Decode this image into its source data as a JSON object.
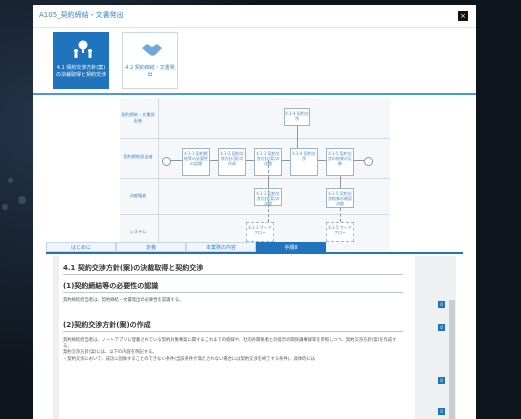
{
  "modal": {
    "title": "A105_契約締結・文書発出",
    "close_label": "×"
  },
  "cards": [
    {
      "label": "4.1 契約交渉方針(案)の決裁取得と契約交渉",
      "icon": "tree-people-icon"
    },
    {
      "label": "4.2 契約締結・文書発出",
      "icon": "handshake-icon"
    }
  ],
  "flow": {
    "lanes": [
      "契約締結・文書発出者",
      "契約締結担当者",
      "決裁権者",
      "システム"
    ],
    "boxes": {
      "b414": "4.1-4 契約交渉",
      "b411": "4.1-1 契約締結等の必要性の認識",
      "b412": "4.1-2 契約交渉方針(案)の作成",
      "b413": "4.1-3 契約交渉方針(案)の決裁",
      "b414b": "4.1-4 契約交渉",
      "b415": "4.1-5 契約交渉の結果の反映",
      "b413d": "4.1-3 契約交渉方針(案)の決裁",
      "b415d": "4.1-5 契約交渉結果の確認決裁",
      "b413s": "4.1-3 ワークフロー",
      "b415s": "4.1-5 ワークフロー"
    }
  },
  "tabs": [
    {
      "label": "はじめに",
      "active": false
    },
    {
      "label": "定義",
      "active": false
    },
    {
      "label": "本業務の内容",
      "active": false
    },
    {
      "label": "手順8",
      "active": true
    }
  ],
  "content": {
    "h1": "4.1 契約交渉方針(案)の決裁取得と契約交渉",
    "s1_title": "(1)契約締結等の必要性の認識",
    "s1_text": "契約締結担当者は、契約締結・文書発出の必要性を認識する。",
    "s2_title": "(2)契約交渉方針(案)の作成",
    "s2_text1": "契約締結担当者は、ノートアプリに登載されている契約対象事案に関するこれまでの経緯や、社内外関係者との提示の関係議事録等を参照しつつ、契約交渉方針(案)を作成する。",
    "s2_text2": "契約交渉方針(案)には、以下の内容を明記する。",
    "s2_text3": "・契約交渉において、成功に固執することのできない条件(当該条件が満たされない場合には契約交渉を終了する条件)、具体的には",
    "badge": "0"
  }
}
